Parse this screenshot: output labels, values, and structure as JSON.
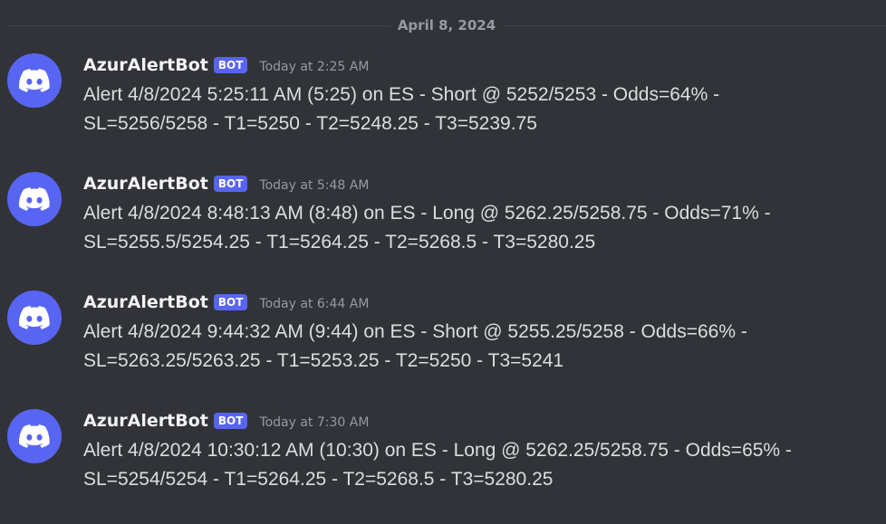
{
  "date_divider": "April 8, 2024",
  "messages": [
    {
      "username": "AzurAlertBot",
      "bot_tag": "BOT",
      "timestamp": "Today at 2:25 AM",
      "line1": "Alert 4/8/2024 5:25:11 AM (5:25) on ES - Short @ 5252/5253 - Odds=64% -",
      "line2": "SL=5256/5258 - T1=5250 - T2=5248.25 - T3=5239.75"
    },
    {
      "username": "AzurAlertBot",
      "bot_tag": "BOT",
      "timestamp": "Today at 5:48 AM",
      "line1": "Alert 4/8/2024 8:48:13 AM (8:48) on ES - Long @ 5262.25/5258.75 - Odds=71% -",
      "line2": "SL=5255.5/5254.25 - T1=5264.25 - T2=5268.5 - T3=5280.25"
    },
    {
      "username": "AzurAlertBot",
      "bot_tag": "BOT",
      "timestamp": "Today at 6:44 AM",
      "line1": "Alert 4/8/2024 9:44:32 AM (9:44) on ES - Short @ 5255.25/5258 - Odds=66% -",
      "line2": "SL=5263.25/5263.25 - T1=5253.25 - T2=5250 - T3=5241"
    },
    {
      "username": "AzurAlertBot",
      "bot_tag": "BOT",
      "timestamp": "Today at 7:30 AM",
      "line1": "Alert 4/8/2024 10:30:12 AM (10:30) on ES - Long @ 5262.25/5258.75 - Odds=65% -",
      "line2": "SL=5254/5254 - T1=5264.25 - T2=5268.5 - T3=5280.25"
    }
  ],
  "colors": {
    "background": "#313338",
    "avatar": "#5865f2",
    "bot_tag": "#5865f2",
    "username": "#f2f3f5",
    "text": "#dbdee1",
    "muted": "#949ba4"
  },
  "icons": {
    "avatar": "discord-logo-icon"
  }
}
